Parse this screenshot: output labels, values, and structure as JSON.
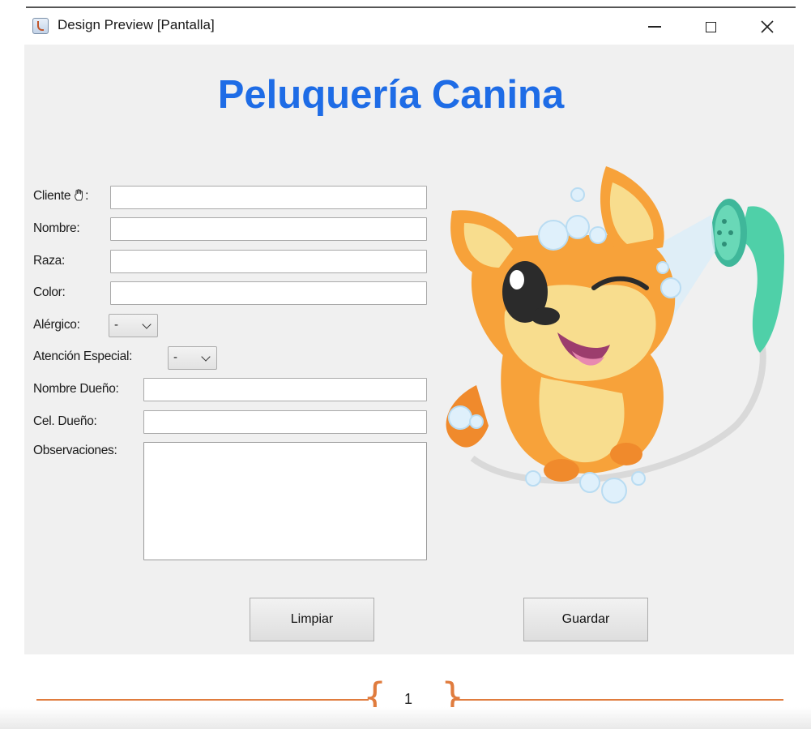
{
  "window": {
    "title": "Design Preview [Pantalla]",
    "controls": [
      "minimize-icon",
      "maximize-icon",
      "close-icon"
    ]
  },
  "heading": "Peluquería Canina",
  "form": {
    "cliente_label": "Cliente",
    "cliente_suffix": ":",
    "nombre_label": "Nombre:",
    "raza_label": "Raza:",
    "color_label": "Color:",
    "alergico_label": "Alérgico:",
    "alergico_value": "-",
    "atencion_label": "Atención Especial:",
    "atencion_value": "-",
    "nombre_dueno_label": "Nombre Dueño:",
    "cel_dueno_label": "Cel. Dueño:",
    "observaciones_label": "Observaciones:"
  },
  "buttons": {
    "limpiar": "Limpiar",
    "guardar": "Guardar"
  },
  "footer": {
    "page_number": "1",
    "open_brace": "{",
    "close_brace": "}"
  },
  "colors": {
    "heading": "#1e6ce6",
    "accent": "#e07c3e"
  },
  "image": "dog-shower-mascot"
}
